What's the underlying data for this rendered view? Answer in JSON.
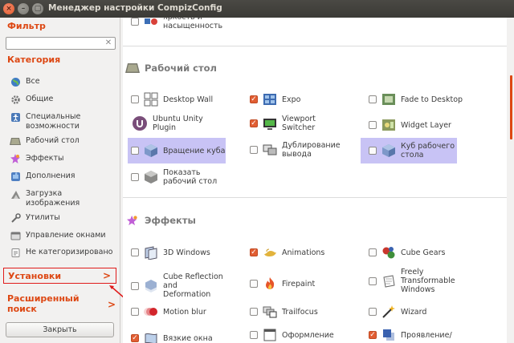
{
  "window": {
    "title": "Менеджер настройки CompizConfig",
    "close_glyph": "×",
    "min_glyph": "–",
    "max_glyph": "▢"
  },
  "sidebar": {
    "filter_title": "Фильтр",
    "filter_value": "",
    "filter_clear_glyph": "✕",
    "category_title": "Категория",
    "categories": [
      {
        "label": "Все",
        "icon": "globe-icon"
      },
      {
        "label": "Общие",
        "icon": "gear-icon"
      },
      {
        "label": "Специальные возможности",
        "icon": "accessibility-icon"
      },
      {
        "label": "Рабочий стол",
        "icon": "desktop-icon"
      },
      {
        "label": "Эффекты",
        "icon": "effects-icon"
      },
      {
        "label": "Дополнения",
        "icon": "puzzle-icon"
      },
      {
        "label": "Загрузка изображения",
        "icon": "image-load-icon"
      },
      {
        "label": "Утилиты",
        "icon": "utilities-icon"
      },
      {
        "label": "Управление окнами",
        "icon": "window-management-icon"
      },
      {
        "label": "Не категоризировано",
        "icon": "uncategorized-icon"
      }
    ],
    "setup_label": "Установки",
    "advanced_search_label": "Расширенный поиск",
    "chevron_glyph": ">",
    "close_button": "Закрыть"
  },
  "top_partial": {
    "label": "яркость и насыщенность",
    "checked": false
  },
  "groups": [
    {
      "title": "Рабочий стол",
      "plugins": [
        {
          "label": "Desktop Wall",
          "checked": false,
          "selected": false
        },
        {
          "label": "Expo",
          "checked": true,
          "selected": false
        },
        {
          "label": "Fade to Desktop",
          "checked": false,
          "selected": false
        },
        {
          "label": "Ubuntu Unity Plugin",
          "checked": null,
          "selected": false
        },
        {
          "label": "Viewport Switcher",
          "checked": true,
          "selected": false
        },
        {
          "label": "Widget Layer",
          "checked": false,
          "selected": false
        },
        {
          "label": "Вращение куба",
          "checked": false,
          "selected": true
        },
        {
          "label": "Дублирование вывода",
          "checked": false,
          "selected": false
        },
        {
          "label": "Куб рабочего стола",
          "checked": false,
          "selected": true
        },
        {
          "label": "Показать рабочий стол",
          "checked": false,
          "selected": false
        }
      ]
    },
    {
      "title": "Эффекты",
      "plugins": [
        {
          "label": "3D Windows",
          "checked": false,
          "selected": false
        },
        {
          "label": "Animations",
          "checked": true,
          "selected": false
        },
        {
          "label": "Cube Gears",
          "checked": false,
          "selected": false
        },
        {
          "label": "Cube Reflection and Deformation",
          "checked": false,
          "selected": false
        },
        {
          "label": "Firepaint",
          "checked": false,
          "selected": false
        },
        {
          "label": "Freely Transformable Windows",
          "checked": false,
          "selected": false
        },
        {
          "label": "Motion blur",
          "checked": false,
          "selected": false
        },
        {
          "label": "Trailfocus",
          "checked": false,
          "selected": false
        },
        {
          "label": "Wizard",
          "checked": false,
          "selected": false
        },
        {
          "label": "Вязкие окна",
          "checked": true,
          "selected": false
        },
        {
          "label": "Оформление",
          "checked": false,
          "selected": false
        },
        {
          "label": "Проявление/",
          "checked": true,
          "selected": false
        }
      ]
    }
  ],
  "colors": {
    "accent": "#dd4814",
    "selection": "#c8c3f5",
    "highlight_box": "#e01b1b"
  }
}
